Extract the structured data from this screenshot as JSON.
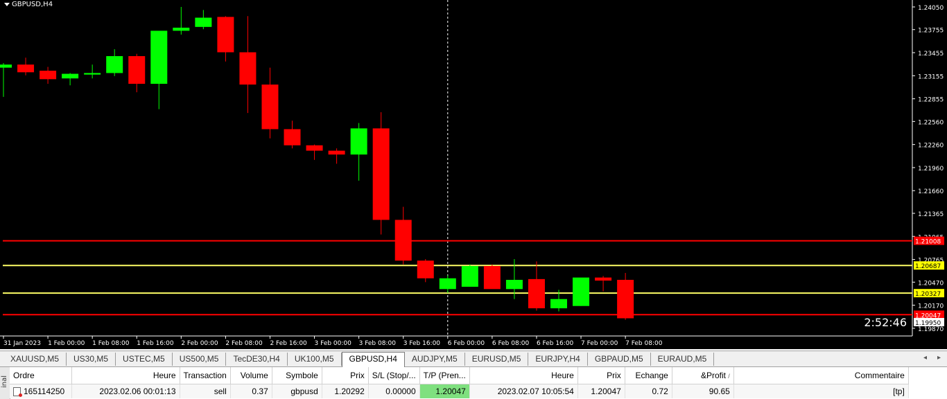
{
  "chart_data": {
    "type": "candlestick",
    "symbol": "GBPUSD,H4",
    "timer": "2:52:46",
    "y_ticks": [
      "1.24050",
      "1.23755",
      "1.23455",
      "1.23155",
      "1.22855",
      "1.22560",
      "1.22260",
      "1.21960",
      "1.21660",
      "1.21365",
      "1.21065",
      "1.20765",
      "1.20470",
      "1.20170",
      "1.19870"
    ],
    "ylim": [
      1.1977,
      1.2414
    ],
    "x_tick_labels": [
      "31 Jan 2023",
      "1 Feb 00:00",
      "1 Feb 08:00",
      "1 Feb 16:00",
      "2 Feb 00:00",
      "2 Feb 08:00",
      "2 Feb 16:00",
      "3 Feb 00:00",
      "3 Feb 08:00",
      "3 Feb 16:00",
      "6 Feb 00:00",
      "6 Feb 08:00",
      "6 Feb 16:00",
      "7 Feb 00:00",
      "7 Feb 08:00"
    ],
    "candles": [
      {
        "o": 1.2326,
        "h": 1.2332,
        "l": 1.2288,
        "c": 1.233
      },
      {
        "o": 1.233,
        "h": 1.2339,
        "l": 1.2316,
        "c": 1.232
      },
      {
        "o": 1.2322,
        "h": 1.2327,
        "l": 1.2305,
        "c": 1.2311
      },
      {
        "o": 1.2312,
        "h": 1.2319,
        "l": 1.2303,
        "c": 1.2318
      },
      {
        "o": 1.2317,
        "h": 1.233,
        "l": 1.2312,
        "c": 1.2319
      },
      {
        "o": 1.2319,
        "h": 1.235,
        "l": 1.2315,
        "c": 1.2341
      },
      {
        "o": 1.2341,
        "h": 1.2344,
        "l": 1.2294,
        "c": 1.2305
      },
      {
        "o": 1.2305,
        "h": 1.2373,
        "l": 1.2272,
        "c": 1.2374
      },
      {
        "o": 1.2374,
        "h": 1.2405,
        "l": 1.2369,
        "c": 1.2378
      },
      {
        "o": 1.2379,
        "h": 1.2401,
        "l": 1.2376,
        "c": 1.2391
      },
      {
        "o": 1.2392,
        "h": 1.2393,
        "l": 1.2334,
        "c": 1.2346
      },
      {
        "o": 1.2346,
        "h": 1.2393,
        "l": 1.2267,
        "c": 1.2304
      },
      {
        "o": 1.2304,
        "h": 1.2326,
        "l": 1.2234,
        "c": 1.2246
      },
      {
        "o": 1.2246,
        "h": 1.2257,
        "l": 1.2221,
        "c": 1.2225
      },
      {
        "o": 1.2225,
        "h": 1.2226,
        "l": 1.2206,
        "c": 1.2218
      },
      {
        "o": 1.2218,
        "h": 1.2221,
        "l": 1.2201,
        "c": 1.2213
      },
      {
        "o": 1.2213,
        "h": 1.2254,
        "l": 1.2179,
        "c": 1.2247
      },
      {
        "o": 1.2247,
        "h": 1.2268,
        "l": 1.2109,
        "c": 1.2128
      },
      {
        "o": 1.2128,
        "h": 1.2145,
        "l": 1.207,
        "c": 1.2075
      },
      {
        "o": 1.2075,
        "h": 1.2077,
        "l": 1.2047,
        "c": 1.2052
      },
      {
        "o": 1.2038,
        "h": 1.2056,
        "l": 1.2033,
        "c": 1.2052
      },
      {
        "o": 1.2041,
        "h": 1.207,
        "l": 1.2041,
        "c": 1.2068
      },
      {
        "o": 1.2068,
        "h": 1.207,
        "l": 1.2039,
        "c": 1.2038
      },
      {
        "o": 1.2038,
        "h": 1.2077,
        "l": 1.2025,
        "c": 1.205
      },
      {
        "o": 1.2051,
        "h": 1.2074,
        "l": 1.201,
        "c": 1.2013
      },
      {
        "o": 1.2013,
        "h": 1.2037,
        "l": 1.2009,
        "c": 1.2025
      },
      {
        "o": 1.2016,
        "h": 1.2052,
        "l": 1.2016,
        "c": 1.2053
      },
      {
        "o": 1.2053,
        "h": 1.2055,
        "l": 1.2035,
        "c": 1.2049
      },
      {
        "o": 1.205,
        "h": 1.2059,
        "l": 1.1998,
        "c": 1.2
      }
    ],
    "hlines": [
      {
        "value": 1.21008,
        "label": "1.21008",
        "color": "#ff0000",
        "label_bg": "#ff0000",
        "label_fg": "#ffffff"
      },
      {
        "value": 1.20687,
        "label": "1.20687",
        "color": "#ffff66",
        "label_bg": "#ffff00",
        "label_fg": "#000000"
      },
      {
        "value": 1.20327,
        "label": "1.20327",
        "color": "#ffff66",
        "label_bg": "#ffff00",
        "label_fg": "#000000"
      },
      {
        "value": 1.20047,
        "label": "1.20047",
        "color": "#ff0000",
        "label_bg": "#ff0000",
        "label_fg": "#ffffff"
      }
    ],
    "bid_label": {
      "value": 1.1995,
      "label": "1.19950"
    },
    "bull_color": "#00ff00",
    "bear_color": "#ff0000"
  },
  "tabs": [
    "XAUUSD,M5",
    "US30,M5",
    "USTEC,M5",
    "US500,M5",
    "TecDE30,H4",
    "UK100,M5",
    "GBPUSD,H4",
    "AUDJPY,M5",
    "EURUSD,M5",
    "EURJPY,H4",
    "GBPAUD,M5",
    "EURAUD,M5"
  ],
  "active_tab": "GBPUSD,H4",
  "terminal": {
    "side_label": "inal",
    "headers": [
      "Ordre",
      "Heure",
      "Transaction",
      "Volume",
      "Symbole",
      "Prix",
      "S/L (Stop/...",
      "T/P (Pren...",
      "Heure",
      "Prix",
      "Echange",
      "&Profit",
      "Commentaire"
    ],
    "sort_marker": "/",
    "row": [
      "165114250",
      "2023.02.06 00:01:13",
      "sell",
      "0.37",
      "gbpusd",
      "1.20292",
      "0.00000",
      "1.20047",
      "2023.02.07 10:05:54",
      "1.20047",
      "0.72",
      "90.65",
      "[tp]"
    ]
  }
}
